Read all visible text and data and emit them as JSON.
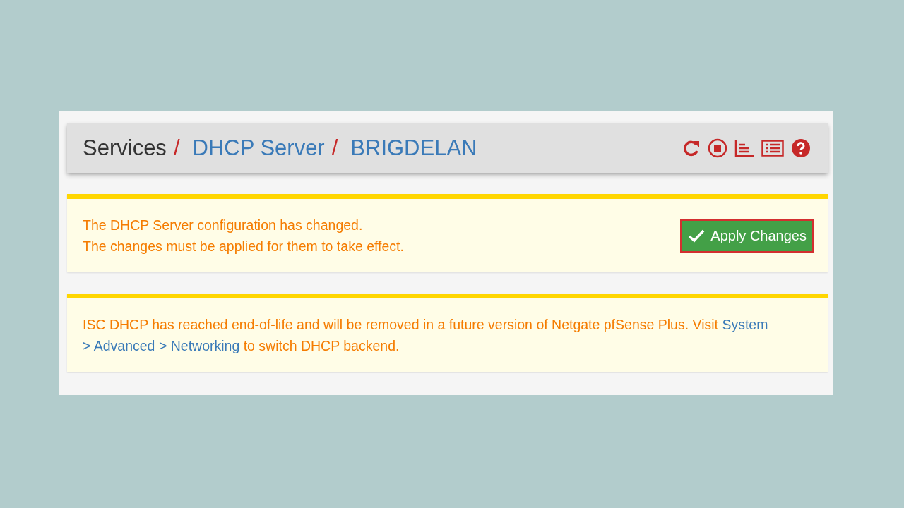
{
  "breadcrumb": [
    {
      "kind": "text",
      "label": "Services"
    },
    {
      "kind": "separator",
      "label": "/"
    },
    {
      "kind": "link",
      "label": "DHCP Server"
    },
    {
      "kind": "separator",
      "label": "/"
    },
    {
      "kind": "link",
      "label": "BRIGDELAN"
    }
  ],
  "notices": [
    {
      "lines": [
        "The DHCP Server configuration has changed.",
        "The changes must be applied for them to take effect."
      ],
      "button": {
        "label": "Apply Changes",
        "highlighted": true
      }
    },
    {
      "parts": [
        {
          "kind": "text",
          "text": "ISC DHCP has reached end-of-life and will be removed in a future version of Netgate pfSense Plus. Visit"
        },
        {
          "kind": "link",
          "text": "System"
        },
        {
          "kind": "link",
          "text": "> Advanced >"
        },
        {
          "kind": "link",
          "text": "Networking"
        },
        {
          "kind": "text",
          "text": "to switch DHCP backend."
        }
      ]
    }
  ]
}
